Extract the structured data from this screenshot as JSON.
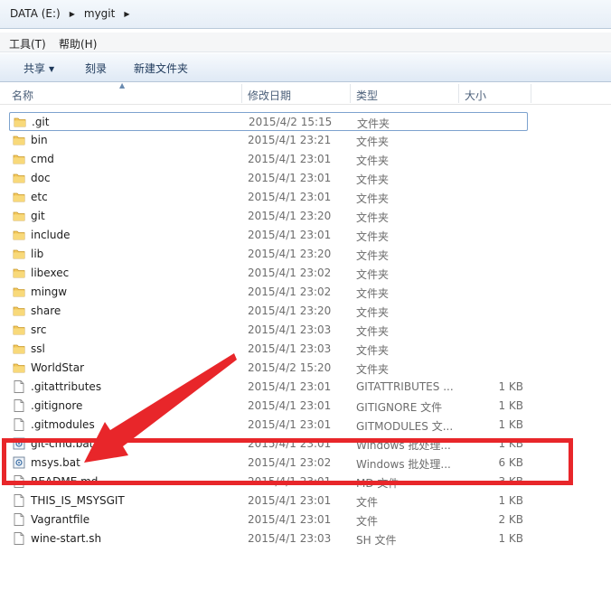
{
  "address": {
    "crumbs": [
      "DATA (E:)",
      "mygit"
    ]
  },
  "menu": {
    "items": [
      "工具(T)",
      "帮助(H)"
    ]
  },
  "toolbar": {
    "share_label": "共享",
    "burn_label": "刻录",
    "new_folder_label": "新建文件夹"
  },
  "columns": {
    "name": "名称",
    "date": "修改日期",
    "type": "类型",
    "size": "大小"
  },
  "files": [
    {
      "name": ".git",
      "date": "2015/4/2 15:15",
      "type": "文件夹",
      "size": "",
      "icon": "folder-icon"
    },
    {
      "name": "bin",
      "date": "2015/4/1 23:21",
      "type": "文件夹",
      "size": "",
      "icon": "folder-icon"
    },
    {
      "name": "cmd",
      "date": "2015/4/1 23:01",
      "type": "文件夹",
      "size": "",
      "icon": "folder-icon"
    },
    {
      "name": "doc",
      "date": "2015/4/1 23:01",
      "type": "文件夹",
      "size": "",
      "icon": "folder-icon"
    },
    {
      "name": "etc",
      "date": "2015/4/1 23:01",
      "type": "文件夹",
      "size": "",
      "icon": "folder-icon"
    },
    {
      "name": "git",
      "date": "2015/4/1 23:20",
      "type": "文件夹",
      "size": "",
      "icon": "folder-icon"
    },
    {
      "name": "include",
      "date": "2015/4/1 23:01",
      "type": "文件夹",
      "size": "",
      "icon": "folder-icon"
    },
    {
      "name": "lib",
      "date": "2015/4/1 23:20",
      "type": "文件夹",
      "size": "",
      "icon": "folder-icon"
    },
    {
      "name": "libexec",
      "date": "2015/4/1 23:02",
      "type": "文件夹",
      "size": "",
      "icon": "folder-icon"
    },
    {
      "name": "mingw",
      "date": "2015/4/1 23:02",
      "type": "文件夹",
      "size": "",
      "icon": "folder-icon"
    },
    {
      "name": "share",
      "date": "2015/4/1 23:20",
      "type": "文件夹",
      "size": "",
      "icon": "folder-icon"
    },
    {
      "name": "src",
      "date": "2015/4/1 23:03",
      "type": "文件夹",
      "size": "",
      "icon": "folder-icon"
    },
    {
      "name": "ssl",
      "date": "2015/4/1 23:03",
      "type": "文件夹",
      "size": "",
      "icon": "folder-icon"
    },
    {
      "name": "WorldStar",
      "date": "2015/4/2 15:20",
      "type": "文件夹",
      "size": "",
      "icon": "folder-icon"
    },
    {
      "name": ".gitattributes",
      "date": "2015/4/1 23:01",
      "type": "GITATTRIBUTES ...",
      "size": "1 KB",
      "icon": "file-icon"
    },
    {
      "name": ".gitignore",
      "date": "2015/4/1 23:01",
      "type": "GITIGNORE 文件",
      "size": "1 KB",
      "icon": "file-icon"
    },
    {
      "name": ".gitmodules",
      "date": "2015/4/1 23:01",
      "type": "GITMODULES 文...",
      "size": "1 KB",
      "icon": "file-icon"
    },
    {
      "name": "git-cmd.bat",
      "date": "2015/4/1 23:01",
      "type": "Windows 批处理...",
      "size": "1 KB",
      "icon": "batch-file-icon"
    },
    {
      "name": "msys.bat",
      "date": "2015/4/1 23:02",
      "type": "Windows 批处理...",
      "size": "6 KB",
      "icon": "batch-file-icon"
    },
    {
      "name": "README.md",
      "date": "2015/4/1 23:01",
      "type": "MD 文件",
      "size": "3 KB",
      "icon": "file-icon"
    },
    {
      "name": "THIS_IS_MSYSGIT",
      "date": "2015/4/1 23:01",
      "type": "文件",
      "size": "1 KB",
      "icon": "file-icon"
    },
    {
      "name": "Vagrantfile",
      "date": "2015/4/1 23:01",
      "type": "文件",
      "size": "2 KB",
      "icon": "file-icon"
    },
    {
      "name": "wine-start.sh",
      "date": "2015/4/1 23:03",
      "type": "SH 文件",
      "size": "1 KB",
      "icon": "file-icon"
    }
  ],
  "colors": {
    "annotation": "#e8262a",
    "folder": "#f2c75c",
    "selection_border": "#7da2ce"
  }
}
